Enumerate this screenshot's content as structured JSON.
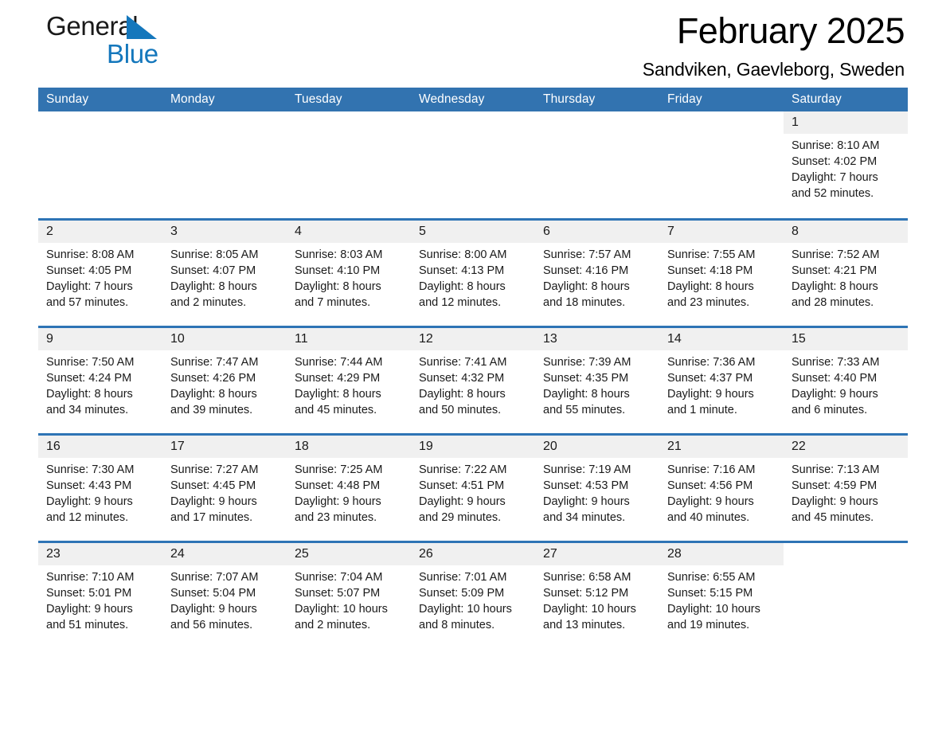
{
  "brand": {
    "name_part1": "General",
    "name_part2": "Blue",
    "triangle_icon": "triangle-icon",
    "accent_color": "#1477bc"
  },
  "header": {
    "title": "February 2025",
    "subtitle": "Sandviken, Gaevleborg, Sweden"
  },
  "colors": {
    "header_blue": "#3273b0",
    "row_divider_blue": "#2e74b5",
    "daynum_band": "#f0f0f0"
  },
  "weekdays": [
    "Sunday",
    "Monday",
    "Tuesday",
    "Wednesday",
    "Thursday",
    "Friday",
    "Saturday"
  ],
  "weeks": [
    [
      {
        "day": "",
        "sunrise": "",
        "sunset": "",
        "daylight1": "",
        "daylight2": "",
        "blank": true,
        "shaded": false
      },
      {
        "day": "",
        "sunrise": "",
        "sunset": "",
        "daylight1": "",
        "daylight2": "",
        "blank": true,
        "shaded": false
      },
      {
        "day": "",
        "sunrise": "",
        "sunset": "",
        "daylight1": "",
        "daylight2": "",
        "blank": true,
        "shaded": false
      },
      {
        "day": "",
        "sunrise": "",
        "sunset": "",
        "daylight1": "",
        "daylight2": "",
        "blank": true,
        "shaded": false
      },
      {
        "day": "",
        "sunrise": "",
        "sunset": "",
        "daylight1": "",
        "daylight2": "",
        "blank": true,
        "shaded": false
      },
      {
        "day": "",
        "sunrise": "",
        "sunset": "",
        "daylight1": "",
        "daylight2": "",
        "blank": true,
        "shaded": false
      },
      {
        "day": "1",
        "sunrise": "Sunrise: 8:10 AM",
        "sunset": "Sunset: 4:02 PM",
        "daylight1": "Daylight: 7 hours",
        "daylight2": "and 52 minutes.",
        "blank": false,
        "shaded": true
      }
    ],
    [
      {
        "day": "2",
        "sunrise": "Sunrise: 8:08 AM",
        "sunset": "Sunset: 4:05 PM",
        "daylight1": "Daylight: 7 hours",
        "daylight2": "and 57 minutes.",
        "blank": false,
        "shaded": true
      },
      {
        "day": "3",
        "sunrise": "Sunrise: 8:05 AM",
        "sunset": "Sunset: 4:07 PM",
        "daylight1": "Daylight: 8 hours",
        "daylight2": "and 2 minutes.",
        "blank": false,
        "shaded": true
      },
      {
        "day": "4",
        "sunrise": "Sunrise: 8:03 AM",
        "sunset": "Sunset: 4:10 PM",
        "daylight1": "Daylight: 8 hours",
        "daylight2": "and 7 minutes.",
        "blank": false,
        "shaded": true
      },
      {
        "day": "5",
        "sunrise": "Sunrise: 8:00 AM",
        "sunset": "Sunset: 4:13 PM",
        "daylight1": "Daylight: 8 hours",
        "daylight2": "and 12 minutes.",
        "blank": false,
        "shaded": true
      },
      {
        "day": "6",
        "sunrise": "Sunrise: 7:57 AM",
        "sunset": "Sunset: 4:16 PM",
        "daylight1": "Daylight: 8 hours",
        "daylight2": "and 18 minutes.",
        "blank": false,
        "shaded": true
      },
      {
        "day": "7",
        "sunrise": "Sunrise: 7:55 AM",
        "sunset": "Sunset: 4:18 PM",
        "daylight1": "Daylight: 8 hours",
        "daylight2": "and 23 minutes.",
        "blank": false,
        "shaded": true
      },
      {
        "day": "8",
        "sunrise": "Sunrise: 7:52 AM",
        "sunset": "Sunset: 4:21 PM",
        "daylight1": "Daylight: 8 hours",
        "daylight2": "and 28 minutes.",
        "blank": false,
        "shaded": true
      }
    ],
    [
      {
        "day": "9",
        "sunrise": "Sunrise: 7:50 AM",
        "sunset": "Sunset: 4:24 PM",
        "daylight1": "Daylight: 8 hours",
        "daylight2": "and 34 minutes.",
        "blank": false,
        "shaded": true
      },
      {
        "day": "10",
        "sunrise": "Sunrise: 7:47 AM",
        "sunset": "Sunset: 4:26 PM",
        "daylight1": "Daylight: 8 hours",
        "daylight2": "and 39 minutes.",
        "blank": false,
        "shaded": true
      },
      {
        "day": "11",
        "sunrise": "Sunrise: 7:44 AM",
        "sunset": "Sunset: 4:29 PM",
        "daylight1": "Daylight: 8 hours",
        "daylight2": "and 45 minutes.",
        "blank": false,
        "shaded": true
      },
      {
        "day": "12",
        "sunrise": "Sunrise: 7:41 AM",
        "sunset": "Sunset: 4:32 PM",
        "daylight1": "Daylight: 8 hours",
        "daylight2": "and 50 minutes.",
        "blank": false,
        "shaded": true
      },
      {
        "day": "13",
        "sunrise": "Sunrise: 7:39 AM",
        "sunset": "Sunset: 4:35 PM",
        "daylight1": "Daylight: 8 hours",
        "daylight2": "and 55 minutes.",
        "blank": false,
        "shaded": true
      },
      {
        "day": "14",
        "sunrise": "Sunrise: 7:36 AM",
        "sunset": "Sunset: 4:37 PM",
        "daylight1": "Daylight: 9 hours",
        "daylight2": "and 1 minute.",
        "blank": false,
        "shaded": true
      },
      {
        "day": "15",
        "sunrise": "Sunrise: 7:33 AM",
        "sunset": "Sunset: 4:40 PM",
        "daylight1": "Daylight: 9 hours",
        "daylight2": "and 6 minutes.",
        "blank": false,
        "shaded": true
      }
    ],
    [
      {
        "day": "16",
        "sunrise": "Sunrise: 7:30 AM",
        "sunset": "Sunset: 4:43 PM",
        "daylight1": "Daylight: 9 hours",
        "daylight2": "and 12 minutes.",
        "blank": false,
        "shaded": true
      },
      {
        "day": "17",
        "sunrise": "Sunrise: 7:27 AM",
        "sunset": "Sunset: 4:45 PM",
        "daylight1": "Daylight: 9 hours",
        "daylight2": "and 17 minutes.",
        "blank": false,
        "shaded": true
      },
      {
        "day": "18",
        "sunrise": "Sunrise: 7:25 AM",
        "sunset": "Sunset: 4:48 PM",
        "daylight1": "Daylight: 9 hours",
        "daylight2": "and 23 minutes.",
        "blank": false,
        "shaded": true
      },
      {
        "day": "19",
        "sunrise": "Sunrise: 7:22 AM",
        "sunset": "Sunset: 4:51 PM",
        "daylight1": "Daylight: 9 hours",
        "daylight2": "and 29 minutes.",
        "blank": false,
        "shaded": true
      },
      {
        "day": "20",
        "sunrise": "Sunrise: 7:19 AM",
        "sunset": "Sunset: 4:53 PM",
        "daylight1": "Daylight: 9 hours",
        "daylight2": "and 34 minutes.",
        "blank": false,
        "shaded": true
      },
      {
        "day": "21",
        "sunrise": "Sunrise: 7:16 AM",
        "sunset": "Sunset: 4:56 PM",
        "daylight1": "Daylight: 9 hours",
        "daylight2": "and 40 minutes.",
        "blank": false,
        "shaded": true
      },
      {
        "day": "22",
        "sunrise": "Sunrise: 7:13 AM",
        "sunset": "Sunset: 4:59 PM",
        "daylight1": "Daylight: 9 hours",
        "daylight2": "and 45 minutes.",
        "blank": false,
        "shaded": true
      }
    ],
    [
      {
        "day": "23",
        "sunrise": "Sunrise: 7:10 AM",
        "sunset": "Sunset: 5:01 PM",
        "daylight1": "Daylight: 9 hours",
        "daylight2": "and 51 minutes.",
        "blank": false,
        "shaded": true
      },
      {
        "day": "24",
        "sunrise": "Sunrise: 7:07 AM",
        "sunset": "Sunset: 5:04 PM",
        "daylight1": "Daylight: 9 hours",
        "daylight2": "and 56 minutes.",
        "blank": false,
        "shaded": true
      },
      {
        "day": "25",
        "sunrise": "Sunrise: 7:04 AM",
        "sunset": "Sunset: 5:07 PM",
        "daylight1": "Daylight: 10 hours",
        "daylight2": "and 2 minutes.",
        "blank": false,
        "shaded": true
      },
      {
        "day": "26",
        "sunrise": "Sunrise: 7:01 AM",
        "sunset": "Sunset: 5:09 PM",
        "daylight1": "Daylight: 10 hours",
        "daylight2": "and 8 minutes.",
        "blank": false,
        "shaded": true
      },
      {
        "day": "27",
        "sunrise": "Sunrise: 6:58 AM",
        "sunset": "Sunset: 5:12 PM",
        "daylight1": "Daylight: 10 hours",
        "daylight2": "and 13 minutes.",
        "blank": false,
        "shaded": true
      },
      {
        "day": "28",
        "sunrise": "Sunrise: 6:55 AM",
        "sunset": "Sunset: 5:15 PM",
        "daylight1": "Daylight: 10 hours",
        "daylight2": "and 19 minutes.",
        "blank": false,
        "shaded": true
      },
      {
        "day": "",
        "sunrise": "",
        "sunset": "",
        "daylight1": "",
        "daylight2": "",
        "blank": true,
        "shaded": false
      }
    ]
  ]
}
